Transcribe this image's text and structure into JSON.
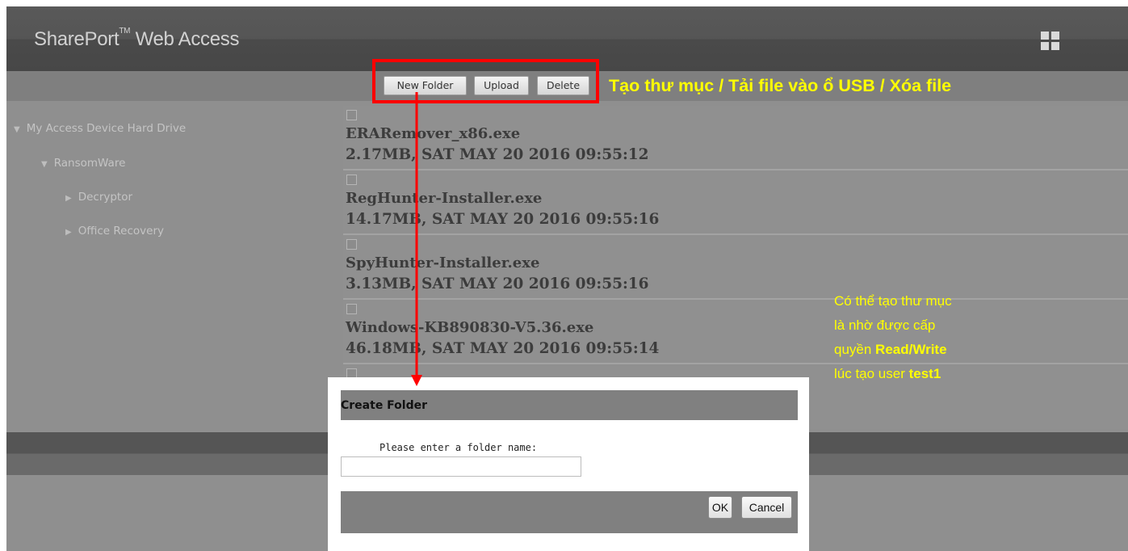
{
  "header": {
    "title_main": "SharePort",
    "title_tm": "TM",
    "title_rest": " Web Access",
    "menu_icon": "grid-icon"
  },
  "toolbar": {
    "new_folder": "New Folder",
    "upload": "Upload",
    "delete": "Delete"
  },
  "annotations": {
    "top": "Tạo thư mục / Tải file vào ổ USB / Xóa file",
    "right_line1": "Có thể tạo thư mục",
    "right_line2": "là nhờ được cấp",
    "right_line3_pre": "quyền ",
    "right_line3_bold": "Read/Write",
    "right_line4_pre": "lúc tạo user ",
    "right_line4_bold": "test1",
    "color": "#ffff00",
    "highlight_color": "#ff0000"
  },
  "sidebar": {
    "items": [
      {
        "label": "My Access Device Hard Drive",
        "icon": "triangle-down-icon"
      },
      {
        "label": "RansomWare",
        "icon": "triangle-down-icon"
      },
      {
        "label": "Decryptor",
        "icon": "triangle-right-icon"
      },
      {
        "label": "Office Recovery",
        "icon": "triangle-right-icon"
      }
    ]
  },
  "files": [
    {
      "name": "ERARemover_x86.exe",
      "meta": "2.17MB, SAT MAY 20 2016 09:55:12"
    },
    {
      "name": "RegHunter-Installer.exe",
      "meta": "14.17MB, SAT MAY 20 2016 09:55:16"
    },
    {
      "name": "SpyHunter-Installer.exe",
      "meta": "3.13MB, SAT MAY 20 2016 09:55:16"
    },
    {
      "name": "Windows-KB890830-V5.36.exe",
      "meta": "46.18MB, SAT MAY 20 2016 09:55:14"
    }
  ],
  "dialog": {
    "title": "Create Folder",
    "label": "Please enter a folder name:",
    "input_value": "",
    "ok": "OK",
    "cancel": "Cancel"
  }
}
